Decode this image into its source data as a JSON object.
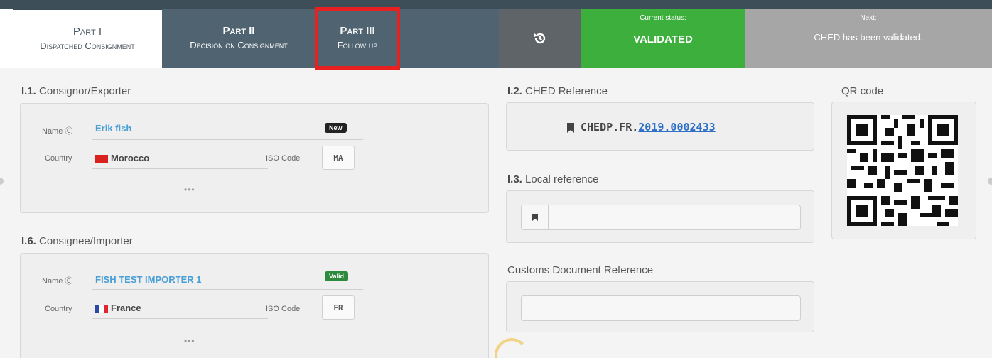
{
  "tabs": [
    {
      "title": "Part I",
      "subtitle": "Dispatched Consignment"
    },
    {
      "title": "Part II",
      "subtitle": "Decision on Consignment"
    },
    {
      "title": "Part III",
      "subtitle": "Follow up"
    }
  ],
  "status": {
    "label": "Current status:",
    "value": "VALIDATED"
  },
  "next": {
    "label": "Next:",
    "value": "CHED has been validated."
  },
  "consignor": {
    "number": "I.1.",
    "heading": "Consignor/Exporter",
    "name_label": "Name Ⓒ",
    "name_value": "Erik fish",
    "badge": "New",
    "country_label": "Country",
    "country_value": "Morocco",
    "iso_label": "ISO Code",
    "iso_value": "MA",
    "more": "•••"
  },
  "consignee": {
    "number": "I.6.",
    "heading": "Consignee/Importer",
    "name_label": "Name Ⓒ",
    "name_value": "FISH TEST IMPORTER 1",
    "badge": "Valid",
    "country_label": "Country",
    "country_value": "France",
    "iso_label": "ISO Code",
    "iso_value": "FR",
    "more": "•••"
  },
  "ched_reference": {
    "number": "I.2.",
    "heading": "CHED Reference",
    "prefix": "CHEDP.FR.",
    "link": "2019.0002433"
  },
  "local_reference": {
    "number": "I.3.",
    "heading": "Local reference",
    "value": ""
  },
  "customs_reference": {
    "heading": "Customs Document Reference",
    "value": ""
  },
  "qr": {
    "heading": "QR code"
  },
  "colors": {
    "highlight": "#e8201f",
    "status_green": "#3caf3c",
    "tab_dark": "#4f6370"
  }
}
